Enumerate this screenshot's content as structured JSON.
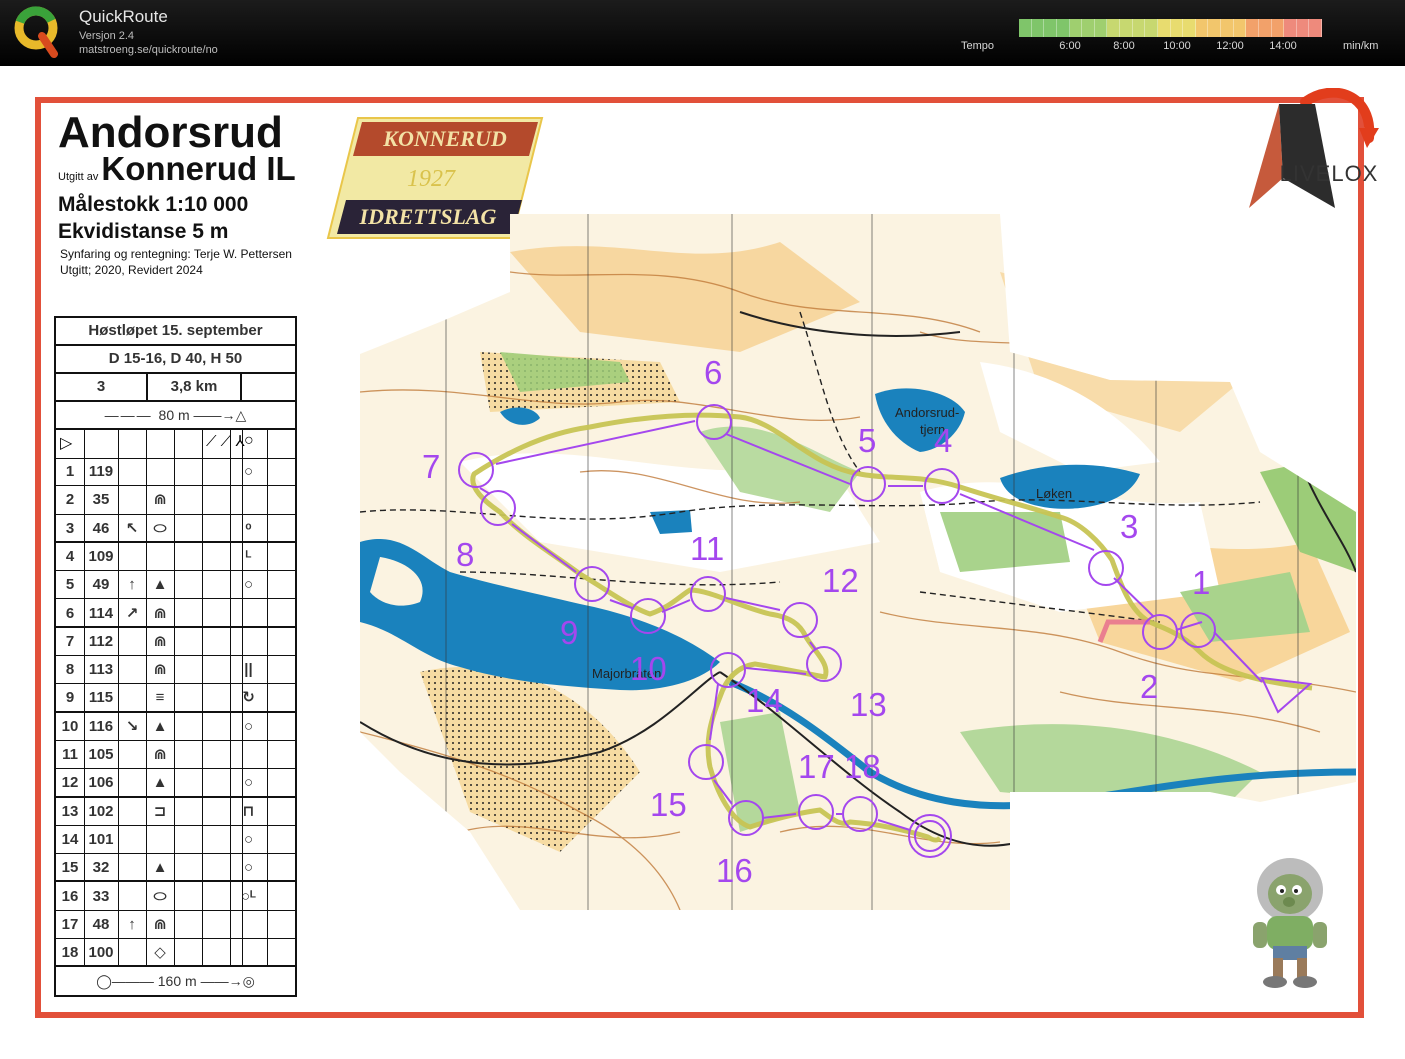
{
  "app": {
    "name": "QuickRoute",
    "version": "Versjon 2.4",
    "url": "matstroeng.se/quickroute/no",
    "tempo_label": "Tempo",
    "tempo_ticks": [
      "6:00",
      "8:00",
      "10:00",
      "12:00",
      "14:00"
    ],
    "tempo_unit": "min/km",
    "tempo_colors": [
      "#7fc56a",
      "#9fcf6f",
      "#c7d870",
      "#e8dc6f",
      "#f2c66c",
      "#f2a16a",
      "#ee8a7c"
    ]
  },
  "map_header": {
    "title": "Andorsrud",
    "publisher_prefix": "Utgitt av",
    "publisher": "Konnerud IL",
    "scale": "Målestokk 1:10 000",
    "contour": "Ekvidistanse 5 m",
    "credits_line1": "Synfaring og rentegning: Terje W. Pettersen",
    "credits_line2": "Utgitt; 2020, Revidert 2024"
  },
  "club_badge": {
    "top": "KONNERUD",
    "year": "1927",
    "bottom": "IDRETTSLAG"
  },
  "livelox": {
    "text": "LIVELOX"
  },
  "course": {
    "event": "Høstløpet 15. september",
    "classes": "D 15-16, D 40, H 50",
    "number": "3",
    "length": "3,8 km",
    "start_note": "80 m",
    "finish_note": "160 m",
    "controls": [
      {
        "n": "1",
        "code": "119",
        "c": "",
        "d": "",
        "f": "",
        "h": "○"
      },
      {
        "n": "2",
        "code": "35",
        "c": "",
        "d": "⋒",
        "f": "",
        "h": ""
      },
      {
        "n": "3",
        "code": "46",
        "c": "↖",
        "d": "⬭",
        "f": "",
        "h": "ᵒ"
      },
      {
        "n": "4",
        "code": "109",
        "c": "",
        "d": "",
        "f": "",
        "h": "ᴸ"
      },
      {
        "n": "5",
        "code": "49",
        "c": "↑",
        "d": "▲",
        "f": "",
        "h": "○"
      },
      {
        "n": "6",
        "code": "114",
        "c": "↗",
        "d": "⋒",
        "f": "",
        "h": ""
      },
      {
        "n": "7",
        "code": "112",
        "c": "",
        "d": "⋒",
        "f": "",
        "h": ""
      },
      {
        "n": "8",
        "code": "113",
        "c": "",
        "d": "⋒",
        "f": "",
        "h": "||"
      },
      {
        "n": "9",
        "code": "115",
        "c": "",
        "d": "≡",
        "f": "",
        "h": "↻"
      },
      {
        "n": "10",
        "code": "116",
        "c": "↘",
        "d": "▲",
        "f": "",
        "h": "○"
      },
      {
        "n": "11",
        "code": "105",
        "c": "",
        "d": "⋒",
        "f": "",
        "h": ""
      },
      {
        "n": "12",
        "code": "106",
        "c": "",
        "d": "▲",
        "f": "",
        "h": "○"
      },
      {
        "n": "13",
        "code": "102",
        "c": "",
        "d": "⊐",
        "f": "",
        "h": "⊓"
      },
      {
        "n": "14",
        "code": "101",
        "c": "",
        "d": "",
        "f": "",
        "h": "○"
      },
      {
        "n": "15",
        "code": "32",
        "c": "",
        "d": "▲",
        "f": "",
        "h": "○"
      },
      {
        "n": "16",
        "code": "33",
        "c": "",
        "d": "⬭",
        "f": "",
        "h": "○ᴸ"
      },
      {
        "n": "17",
        "code": "48",
        "c": "↑",
        "d": "⋒",
        "f": "",
        "h": ""
      },
      {
        "n": "18",
        "code": "100",
        "c": "",
        "d": "◇",
        "f": "",
        "h": ""
      }
    ]
  },
  "map": {
    "lake_labels": [
      "Andorsrud-\ntjern",
      "Løken",
      "Majorbråten"
    ],
    "control_labels": [
      "1",
      "2",
      "3",
      "4",
      "5",
      "6",
      "7",
      "8",
      "9",
      "10",
      "11",
      "12",
      "13",
      "14",
      "15",
      "16",
      "17",
      "18"
    ]
  }
}
